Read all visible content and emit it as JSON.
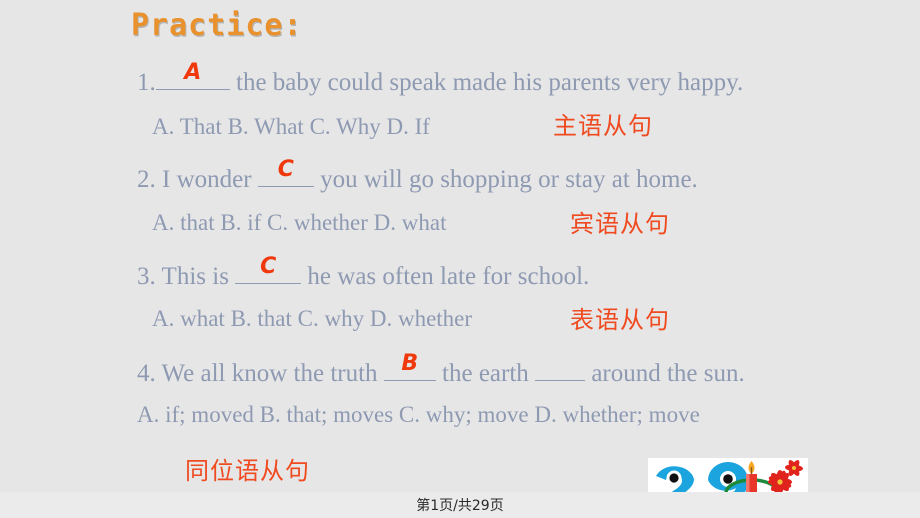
{
  "slide": {
    "background_color": "#e6e6e6",
    "title": "Practice:",
    "title_color": "#e8912d",
    "body_text_color": "#8e99b2",
    "answer_color": "#f0380d",
    "annotation_color": "#f04a20"
  },
  "questions": [
    {
      "number": "1.",
      "stem_before": "",
      "answer": "A",
      "stem_after": " the baby could speak made his parents very happy.",
      "options": "A. That   B. What   C. Why    D. If",
      "annotation": "主语从句"
    },
    {
      "number": "2.",
      "stem_before": " I wonder ",
      "answer": "C",
      "stem_after": " you will go shopping or stay at home.",
      "options": "A. that     B. if     C. whether  D. what",
      "annotation": "宾语从句"
    },
    {
      "number": "3.",
      "stem_before": " This is ",
      "answer": "C",
      "stem_after": " he was often late for school.",
      "options": "A. what  B. that   C. why   D. whether",
      "annotation": "表语从句"
    },
    {
      "number": "4.",
      "stem_before": " We all know the truth ",
      "answer": "B",
      "stem_after_1": " the earth ",
      "answer_2": "",
      "stem_after_2": " around the sun.",
      "options": "A. if; moved  B. that; moves   C. why; move  D. whether; move",
      "annotation": "同位语从句"
    }
  ],
  "footer": {
    "page_indicator": "第1页/共29页"
  },
  "decoration": {
    "name": "christmas-29-graphic",
    "colors": {
      "digits": "#1ba4dd",
      "candle": "#e8362a",
      "flame": "#f5a623",
      "flowers": "#e0231c",
      "foliage": "#1e8a3c",
      "smile": "#e0231c"
    }
  }
}
